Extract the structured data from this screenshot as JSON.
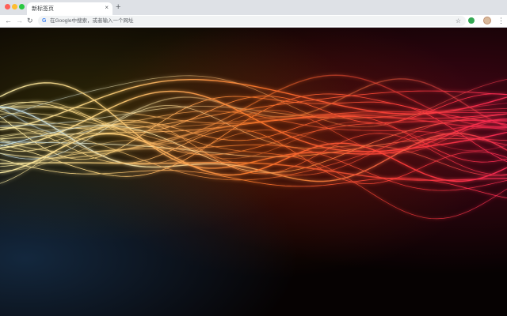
{
  "tab": {
    "title": "新标签页",
    "close_glyph": "×",
    "new_tab_glyph": "+"
  },
  "toolbar": {
    "back_glyph": "←",
    "forward_glyph": "→",
    "reload_glyph": "↻",
    "search_engine_glyph": "G",
    "omnibox_placeholder": "在Google中搜索，或者输入一个网址",
    "bookmark_glyph": "☆",
    "menu_glyph": "⋮"
  },
  "colors": {
    "tabstrip_bg": "#dee1e6",
    "wave_left": "#ffe08a",
    "wave_mid": "#ff7a2a",
    "wave_right": "#ff2a4a"
  },
  "icons": {
    "close": "close-window-dot",
    "minimize": "minimize-window-dot",
    "maximize": "maximize-window-dot",
    "extension": "extension-icon",
    "avatar": "profile-avatar"
  }
}
